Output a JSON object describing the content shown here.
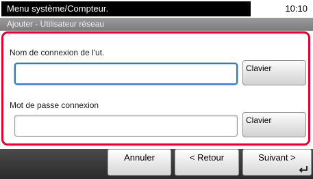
{
  "header": {
    "title": "Menu système/Compteur.",
    "time": "10:10"
  },
  "subtitle": "Ajouter - Utilisateur réseau",
  "form": {
    "login_label": "Nom de connexion de l'ut.",
    "login_value": "",
    "password_label": "Mot de passe connexion",
    "password_value": "",
    "keyboard_label": "Clavier"
  },
  "footer": {
    "cancel_label": "Annuler",
    "back_label": "< Retour",
    "next_label": "Suivant >"
  },
  "colors": {
    "highlight_border": "#e5002d",
    "focus_border": "#3877c9"
  },
  "icons": {
    "next_button": "enter-return-icon"
  }
}
